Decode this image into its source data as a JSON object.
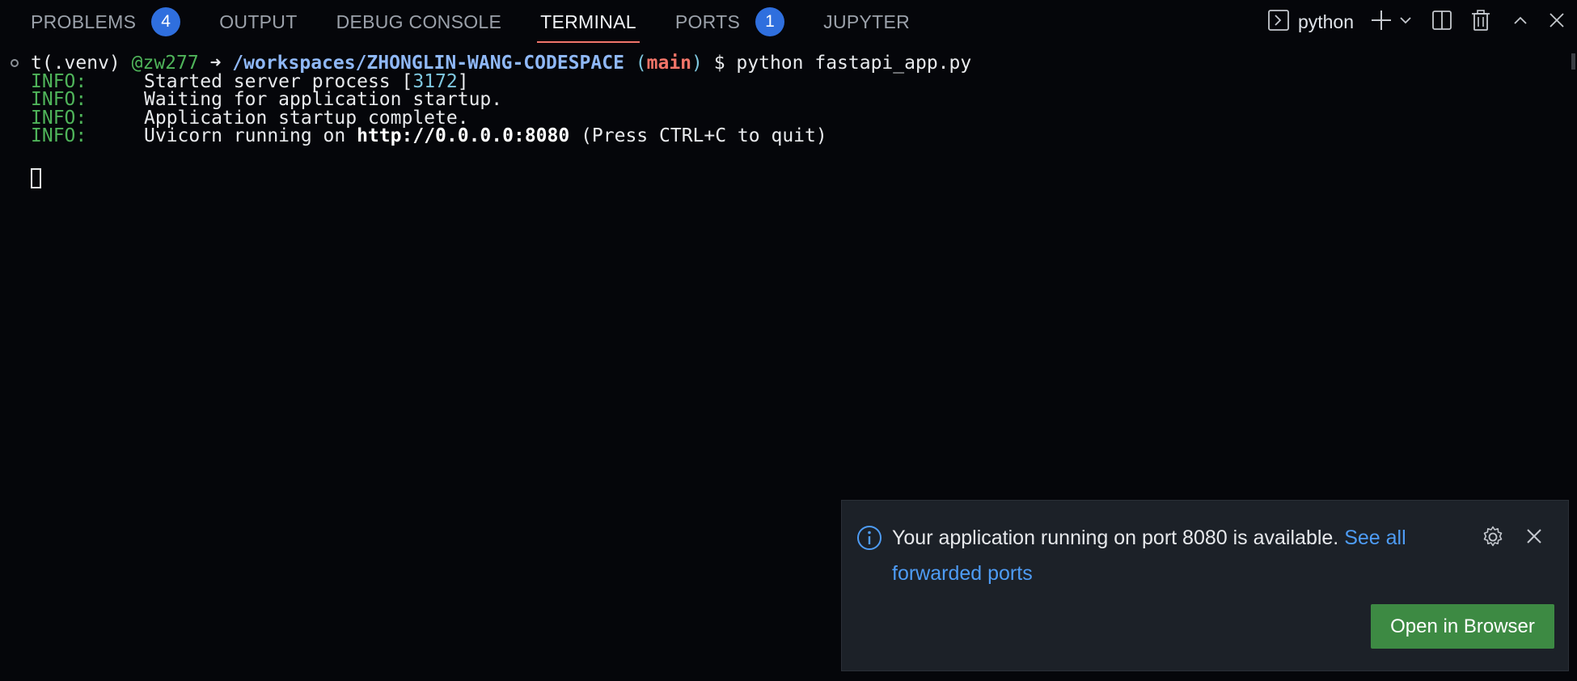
{
  "tabs": [
    {
      "label": "PROBLEMS",
      "badge": "4"
    },
    {
      "label": "OUTPUT"
    },
    {
      "label": "DEBUG CONSOLE"
    },
    {
      "label": "TERMINAL",
      "active": true
    },
    {
      "label": "PORTS",
      "badge": "1"
    },
    {
      "label": "JUPYTER"
    }
  ],
  "actions": {
    "terminal_name": "python",
    "icons": [
      "terminal-icon",
      "plus-icon",
      "chevron-down-icon",
      "split-icon",
      "trash-icon",
      "chevron-up-icon",
      "close-icon"
    ]
  },
  "terminal": {
    "prompt": {
      "prefix": "t(.venv) ",
      "user": "@zw277",
      "arrow": " ➜ ",
      "path": "/workspaces/ZHONGLIN-WANG-CODESPACE",
      "branch_open": " (",
      "branch": "main",
      "branch_close": ")",
      "command": " $ python fastapi_app.py"
    },
    "log": [
      {
        "level": "INFO:",
        "text": "Started server process [",
        "pid": "3172",
        "text_after": "]"
      },
      {
        "level": "INFO:",
        "text": "Waiting for application startup."
      },
      {
        "level": "INFO:",
        "text": "Application startup complete."
      },
      {
        "level": "INFO:",
        "text": "Uvicorn running on ",
        "url": "http://0.0.0.0:8080",
        "text_after": " (Press CTRL+C to quit)"
      }
    ]
  },
  "notification": {
    "message": "Your application running on port 8080 is available. ",
    "link": "See all forwarded ports",
    "button": "Open in Browser"
  },
  "colors": {
    "background": "#05060a",
    "accent_underline": "#f0756b",
    "badge": "#2f6fde",
    "log_level": "#4fb45a",
    "path": "#8fb8f7",
    "branch": "#f07468",
    "toast_bg": "#1c2128",
    "button": "#3d8a43",
    "link": "#4e9cf5"
  }
}
